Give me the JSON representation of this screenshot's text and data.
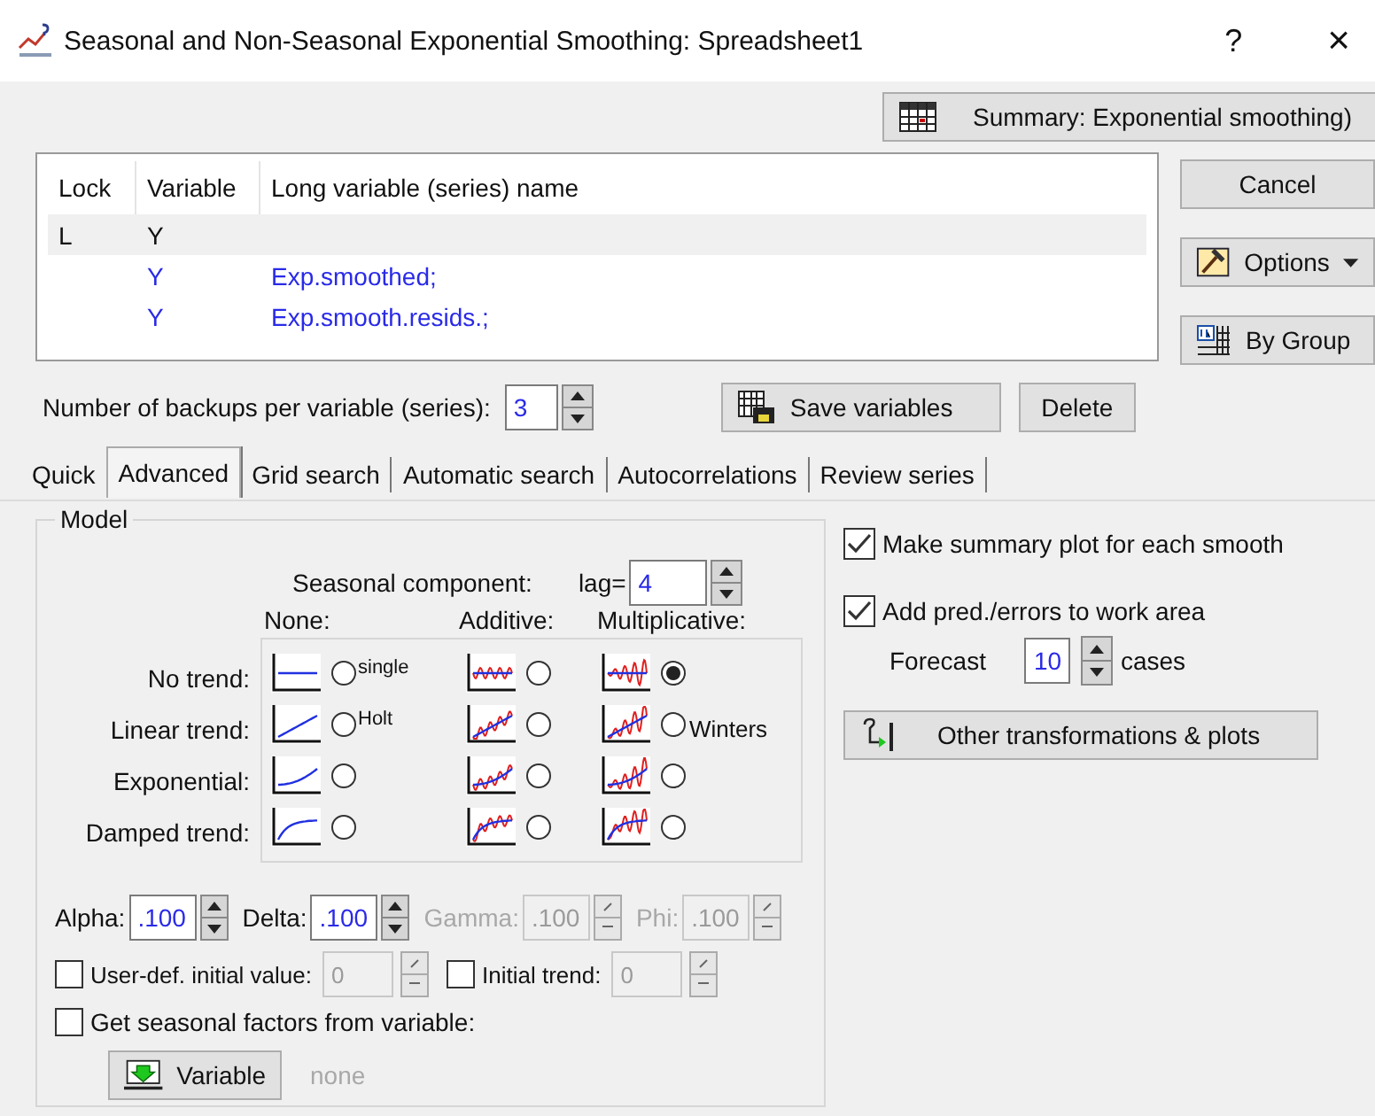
{
  "window": {
    "title": "Seasonal and Non-Seasonal Exponential Smoothing: Spreadsheet1",
    "help": "?",
    "close": "×"
  },
  "summary_button": "Summary:  Exponential smoothing)",
  "table": {
    "columns": [
      "Lock",
      "Variable",
      "Long variable (series) name"
    ],
    "rows": [
      {
        "lock": "L",
        "variable": "Y",
        "selected": true,
        "kind": "source"
      },
      {
        "variable": "Y",
        "name": "Exp.smoothed;",
        "selected": false,
        "kind": "result"
      },
      {
        "variable": "Y",
        "name": "Exp.smooth.resids.;",
        "selected": false,
        "kind": "result"
      }
    ]
  },
  "cancel_button": "Cancel",
  "options_button": "Options",
  "by_group_button": "By Group",
  "backups": {
    "label": "Number of backups per variable (series):",
    "value": "3"
  },
  "save_variables_button": "Save variables",
  "delete_button": "Delete",
  "tabs": [
    {
      "label": "Quick",
      "selected": false
    },
    {
      "label": "Advanced",
      "selected": true
    },
    {
      "label": "Grid search",
      "selected": false
    },
    {
      "label": "Automatic search",
      "selected": false
    },
    {
      "label": "Autocorrelations",
      "selected": false
    },
    {
      "label": "Review series",
      "selected": false
    }
  ],
  "model": {
    "title": "Model",
    "seasonal_label": "Seasonal component:",
    "lag_label": "lag=",
    "lag": "4",
    "columns": [
      {
        "label": "None:",
        "kind": "none"
      },
      {
        "label": "Additive:",
        "kind": "additive"
      },
      {
        "label": "Multiplicative:",
        "kind": "multiplicative"
      }
    ],
    "rows": [
      {
        "label": "No trend:",
        "kind": "none",
        "cells": [
          {
            "selected": false,
            "note": "single"
          },
          {
            "selected": false
          },
          {
            "selected": true
          }
        ]
      },
      {
        "label": "Linear trend:",
        "kind": "linear",
        "cells": [
          {
            "selected": false,
            "note": "Holt"
          },
          {
            "selected": false
          },
          {
            "selected": false,
            "note": "Winters"
          }
        ]
      },
      {
        "label": "Exponential:",
        "kind": "exponential",
        "cells": [
          {
            "selected": false
          },
          {
            "selected": false
          },
          {
            "selected": false
          }
        ]
      },
      {
        "label": "Damped trend:",
        "kind": "damped",
        "cells": [
          {
            "selected": false
          },
          {
            "selected": false
          },
          {
            "selected": false
          }
        ]
      }
    ]
  },
  "params": [
    {
      "label": "Alpha:",
      "value": ".100",
      "disabled": false
    },
    {
      "label": "Delta:",
      "value": ".100",
      "disabled": false
    },
    {
      "label": "Gamma:",
      "value": ".100",
      "disabled": true
    },
    {
      "label": "Phi:",
      "value": ".100",
      "disabled": true
    }
  ],
  "initial": [
    {
      "label": "User-def. initial value:",
      "checked": false,
      "value": "0",
      "disabled": true
    },
    {
      "label": "Initial trend:",
      "checked": false,
      "value": "0",
      "disabled": true
    }
  ],
  "seasonal_factors": {
    "label": "Get seasonal factors from variable:",
    "checked": false
  },
  "variable_button": "Variable",
  "variable_value": "none",
  "options": [
    {
      "label": "Make summary plot for each smooth",
      "checked": true
    },
    {
      "label": "Add pred./errors to work area",
      "checked": true
    }
  ],
  "forecast": {
    "label": "Forecast",
    "value": "10",
    "unit": "cases"
  },
  "other_button": "Other transformations & plots"
}
